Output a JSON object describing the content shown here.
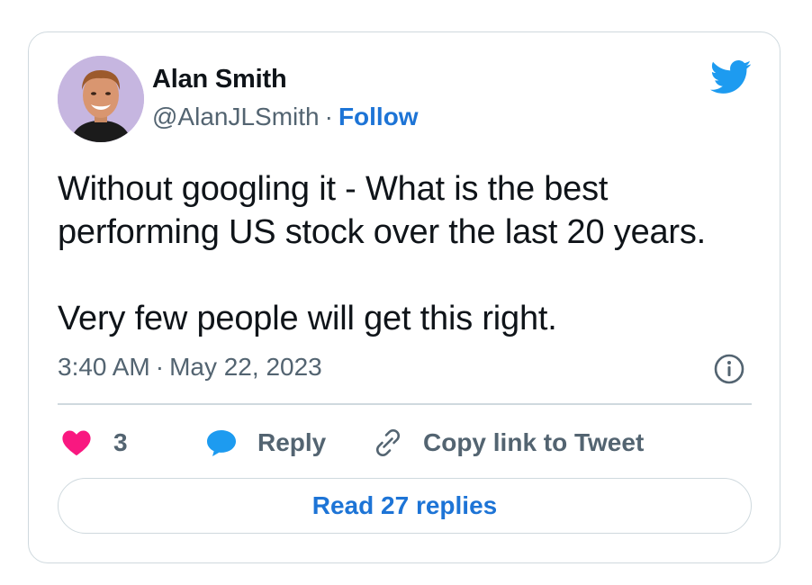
{
  "author": {
    "name": "Alan Smith",
    "handle": "@AlanJLSmith",
    "separator": "·",
    "follow_label": "Follow"
  },
  "tweet": {
    "line1": "Without googling it - What is the best performing US stock over the last 20 years.",
    "line2": "Very few people will get this right.",
    "time": "3:40 AM",
    "separator": "·",
    "date": "May 22, 2023"
  },
  "actions": {
    "like_count": "3",
    "reply_label": "Reply",
    "copy_link_label": "Copy link to Tweet",
    "read_replies_label": "Read 27 replies"
  },
  "icons": {
    "brand": "twitter-bird-icon",
    "info": "info-icon",
    "like": "heart-icon",
    "reply": "speech-bubble-icon",
    "copy": "link-icon"
  },
  "colors": {
    "twitter_blue": "#1d9bf0",
    "link_blue": "#1d74d6",
    "like_pink": "#f91880",
    "muted_text": "#536471",
    "border": "#cfd9de"
  }
}
